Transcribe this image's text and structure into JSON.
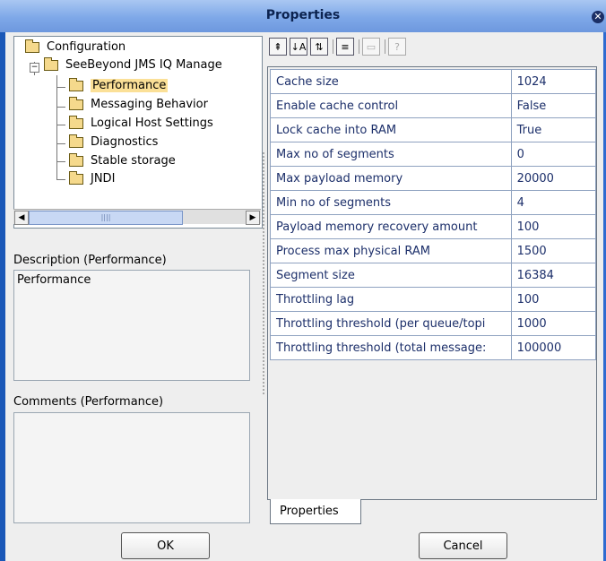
{
  "window": {
    "title": "Properties",
    "close_icon": "close-icon"
  },
  "tree": {
    "root": {
      "label": "Configuration",
      "icon": "folder-icon"
    },
    "server": {
      "label": "SeeBeyond JMS IQ Manage",
      "icon": "folder-icon",
      "expanded": true
    },
    "children": [
      {
        "label": "Performance",
        "selected": true
      },
      {
        "label": "Messaging Behavior"
      },
      {
        "label": "Logical Host Settings"
      },
      {
        "label": "Diagnostics"
      },
      {
        "label": "Stable storage"
      },
      {
        "label": "JNDI"
      }
    ]
  },
  "description": {
    "label": "Description (Performance)",
    "text": "Performance"
  },
  "comments": {
    "label": "Comments (Performance)",
    "text": ""
  },
  "toolbar": {
    "buttons": [
      {
        "icon": "collapse-all-icon",
        "glyph": "⇞"
      },
      {
        "icon": "sort-alphabetical-icon",
        "glyph": "↓A"
      },
      {
        "icon": "sort-categorized-icon",
        "glyph": "⇅"
      },
      {
        "icon": "show-descriptions-icon",
        "glyph": "≡"
      },
      {
        "icon": "window-icon",
        "glyph": "▭"
      },
      {
        "icon": "help-icon",
        "glyph": "?"
      }
    ]
  },
  "properties": [
    {
      "name": "Cache size",
      "value": "1024"
    },
    {
      "name": "Enable cache control",
      "value": "False"
    },
    {
      "name": "Lock cache into RAM",
      "value": "True"
    },
    {
      "name": "Max no of segments",
      "value": "0"
    },
    {
      "name": "Max payload memory",
      "value": "20000"
    },
    {
      "name": "Min no of segments",
      "value": "4"
    },
    {
      "name": "Payload memory recovery amount",
      "value": "100"
    },
    {
      "name": "Process max physical RAM",
      "value": "1500"
    },
    {
      "name": "Segment size",
      "value": "16384"
    },
    {
      "name": "Throttling lag",
      "value": "100"
    },
    {
      "name": "Throttling threshold (per queue/topi",
      "value": "1000"
    },
    {
      "name": "Throttling threshold (total message:",
      "value": "100000"
    }
  ],
  "tab": {
    "label": "Properties"
  },
  "buttons": {
    "ok": "OK",
    "cancel": "Cancel"
  },
  "colors": {
    "title_bar": "#7ea8e8",
    "border": "#1a57b7",
    "selection": "#fbe097",
    "text": "#1c2f6a"
  }
}
